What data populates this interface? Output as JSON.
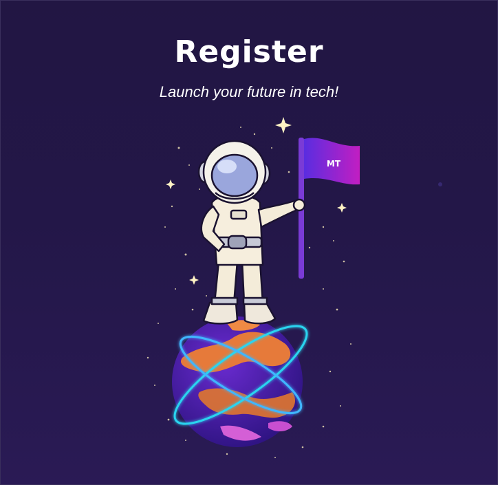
{
  "header": {
    "title": "Register",
    "subtitle": "Launch your future in tech!"
  },
  "illustration": {
    "flag_text": "MT",
    "icons": [
      "astronaut-icon",
      "planet-icon",
      "flag-icon",
      "sparkle-icon"
    ]
  },
  "colors": {
    "background": "#221643",
    "text": "#ffffff",
    "flag": "#8b2fd6",
    "planet_purple": "#4b1fa6",
    "planet_orange": "#e67a3a",
    "ring": "#29d4f0"
  }
}
